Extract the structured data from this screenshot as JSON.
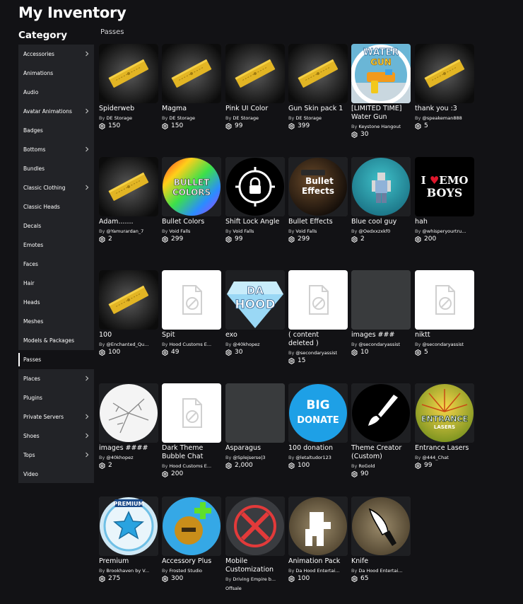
{
  "page": {
    "title": "My Inventory",
    "category_heading": "Category",
    "section_label": "Passes"
  },
  "sidebar": {
    "items": [
      {
        "label": "Accessories",
        "expandable": true,
        "active": false
      },
      {
        "label": "Animations",
        "expandable": false,
        "active": false
      },
      {
        "label": "Audio",
        "expandable": false,
        "active": false
      },
      {
        "label": "Avatar Animations",
        "expandable": true,
        "active": false
      },
      {
        "label": "Badges",
        "expandable": false,
        "active": false
      },
      {
        "label": "Bottoms",
        "expandable": true,
        "active": false
      },
      {
        "label": "Bundles",
        "expandable": false,
        "active": false
      },
      {
        "label": "Classic Clothing",
        "expandable": true,
        "active": false
      },
      {
        "label": "Classic Heads",
        "expandable": false,
        "active": false
      },
      {
        "label": "Decals",
        "expandable": false,
        "active": false
      },
      {
        "label": "Emotes",
        "expandable": false,
        "active": false
      },
      {
        "label": "Faces",
        "expandable": false,
        "active": false
      },
      {
        "label": "Hair",
        "expandable": false,
        "active": false
      },
      {
        "label": "Heads",
        "expandable": false,
        "active": false
      },
      {
        "label": "Meshes",
        "expandable": false,
        "active": false
      },
      {
        "label": "Models & Packages",
        "expandable": false,
        "active": false
      },
      {
        "label": "Passes",
        "expandable": false,
        "active": true
      },
      {
        "label": "Places",
        "expandable": true,
        "active": false
      },
      {
        "label": "Plugins",
        "expandable": false,
        "active": false
      },
      {
        "label": "Private Servers",
        "expandable": true,
        "active": false
      },
      {
        "label": "Shoes",
        "expandable": true,
        "active": false
      },
      {
        "label": "Tops",
        "expandable": true,
        "active": false
      },
      {
        "label": "Video",
        "expandable": false,
        "active": false
      }
    ]
  },
  "by_label": "By",
  "robux_icon": "robux-icon",
  "items": [
    {
      "name": "Spiderweb",
      "creator": "DE Storage",
      "price": "150",
      "thumb": "ticket"
    },
    {
      "name": "Magma",
      "creator": "DE Storage",
      "price": "150",
      "thumb": "ticket"
    },
    {
      "name": "Pink UI Color",
      "creator": "DE Storage",
      "price": "99",
      "thumb": "ticket"
    },
    {
      "name": "Gun Skin pack 1",
      "creator": "DE Storage",
      "price": "399",
      "thumb": "ticket"
    },
    {
      "name": "[LIMITED TIME]\nWater Gun",
      "creator": "Keystone Hangout",
      "price": "30",
      "thumb": "watergun",
      "thumb_text": "WATER GUN"
    },
    {
      "name": "thank you :3",
      "creator": "@speakeman888",
      "price": "5",
      "thumb": "ticket"
    },
    {
      "name": "Adam.......",
      "creator": "@Yamurardan_7",
      "price": "2",
      "thumb": "ticket"
    },
    {
      "name": "Bullet Colors",
      "creator": "Void Falls",
      "price": "299",
      "thumb": "bulletcolors",
      "thumb_text": "BULLET COLORS"
    },
    {
      "name": "Shift Lock Angle",
      "creator": "Void Falls",
      "price": "99",
      "thumb": "shiftlock"
    },
    {
      "name": "Bullet Effects",
      "creator": "Void Falls",
      "price": "299",
      "thumb": "bulleteffects",
      "thumb_text": "Bullet Effects"
    },
    {
      "name": "Blue cool guy",
      "creator": "@Oedxxzxkf0",
      "price": "2",
      "thumb": "blueguy"
    },
    {
      "name": "hah",
      "creator": "@whisperyourtru...",
      "price": "200",
      "thumb": "emoboys",
      "thumb_text": "I ♥ EMO BOYS"
    },
    {
      "name": "100",
      "creator": "@Enchanted_Qu...",
      "price": "100",
      "thumb": "ticket"
    },
    {
      "name": "Spit",
      "creator": "Hood Customs E...",
      "price": "49",
      "thumb": "placeholder"
    },
    {
      "name": "exo",
      "creator": "@40khopez",
      "price": "30",
      "thumb": "dahood",
      "thumb_text": "DA HOOD"
    },
    {
      "name": "( content\ndeleted )",
      "creator": "@secondaryassist",
      "price": "15",
      "thumb": "placeholder"
    },
    {
      "name": "images ###",
      "creator": "@secondaryassist",
      "price": "10",
      "thumb": "empty"
    },
    {
      "name": "niktt",
      "creator": "@secondaryassist",
      "price": "5",
      "thumb": "placeholder"
    },
    {
      "name": "images ####",
      "creator": "@40khopez",
      "price": "2",
      "thumb": "cracked"
    },
    {
      "name": "Dark Theme\nBubble Chat",
      "creator": "Hood Customs E...",
      "price": "200",
      "thumb": "placeholder"
    },
    {
      "name": "Asparagus",
      "creator": "@Splejserse|3",
      "price": "2,000",
      "thumb": "empty"
    },
    {
      "name": "100 donation",
      "creator": "@letaltudor123",
      "price": "100",
      "thumb": "bigdonate",
      "thumb_text": "BIG DONATE"
    },
    {
      "name": "Theme Creator\n(Custom)",
      "creator": "RoGold",
      "price": "90",
      "thumb": "brush"
    },
    {
      "name": "Entrance Lasers",
      "creator": "@444_Chat",
      "price": "99",
      "thumb": "lasers",
      "thumb_text": "ENTRANCE LASERS"
    },
    {
      "name": "Premium",
      "creator": "Brookhaven by V...",
      "price": "275",
      "thumb": "premium",
      "thumb_text": "PREMIUM"
    },
    {
      "name": "Accessory Plus",
      "creator": "Frosted Studio",
      "price": "300",
      "thumb": "accessoryplus"
    },
    {
      "name": "Mobile\nCustomization",
      "creator": "Driving Empire b...",
      "price": "",
      "offsale": "Offsale",
      "thumb": "mobilecustom"
    },
    {
      "name": "Animation Pack",
      "creator": "Da Hood Entertai...",
      "price": "100",
      "thumb": "animpack"
    },
    {
      "name": "Knife",
      "creator": "Da Hood Entertai...",
      "price": "65",
      "thumb": "knife"
    }
  ]
}
